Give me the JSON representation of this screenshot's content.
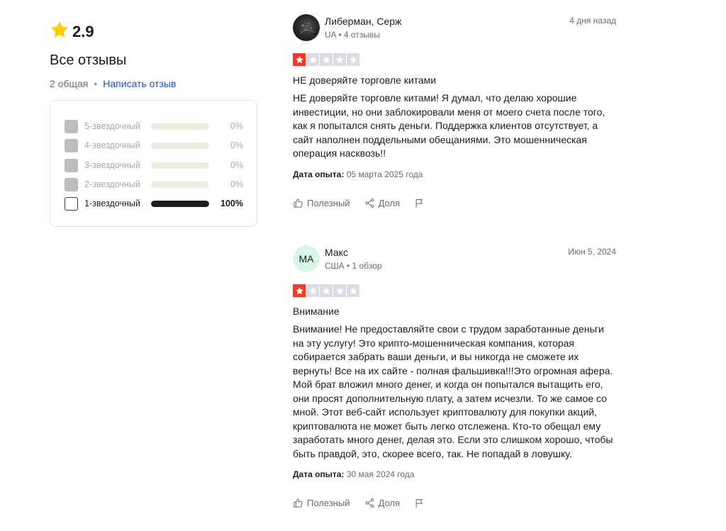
{
  "summary": {
    "rating": "2.9",
    "all_reviews_title": "Все отзывы",
    "total": "2 общая",
    "separator": "•",
    "write_review": "Написать отзыв"
  },
  "distribution": [
    {
      "label": "5-звездочный",
      "percent": "0%",
      "fraction": 0,
      "enabled": false
    },
    {
      "label": "4-звездочный",
      "percent": "0%",
      "fraction": 0,
      "enabled": false
    },
    {
      "label": "3-звездочный",
      "percent": "0%",
      "fraction": 0,
      "enabled": false
    },
    {
      "label": "2-звездочный",
      "percent": "0%",
      "fraction": 0,
      "enabled": false
    },
    {
      "label": "1-звездочный",
      "percent": "100%",
      "fraction": 1,
      "enabled": true
    }
  ],
  "reviews": [
    {
      "author": "Либерман, Серж",
      "meta": "UA • 4 отзывы",
      "date": "4 дня назад",
      "rating": 1,
      "title": "НЕ доверяйте торговле китами",
      "body": "НЕ доверяйте торговле китами! Я думал, что делаю хорошие инвестиции, но они заблокировали меня от моего счета после того, как я попытался снять деньги. Поддержка клиентов отсутствует, а сайт наполнен поддельными обещаниями. Это мошенническая операция насквозь!!",
      "experience_label": "Дата опыта:",
      "experience_date": "05 марта 2025 года",
      "helpful": "Полезный",
      "share": "Доля"
    },
    {
      "author": "Макс",
      "avatar_initials": "MA",
      "meta": "США • 1 обзор",
      "date": "Июн 5, 2024",
      "rating": 1,
      "title": "Внимание",
      "body": "Внимание! Не предоставляйте свои с трудом заработанные деньги на эту услугу! Это крипто-мошенническая компания, которая собирается забрать ваши деньги, и вы никогда не сможете их вернуть! Все на их сайте - полная фальшивка!!!Это огромная афера. Мой брат вложил много денег, и когда он попытался вытащить его, они просят дополнительную плату, а затем исчезли. То же самое со мной. Этот веб-сайт использует криптовалюту для покупки акций, криптовалюта не может быть легко отслежена. Кто-то обещал ему заработать много денег, делая это. Если это слишком хорошо, чтобы быть правдой, это, скорее всего, так. Не попадай в ловушку.",
      "experience_label": "Дата опыта:",
      "experience_date": "30 мая 2024 года",
      "helpful": "Полезный",
      "share": "Доля"
    }
  ],
  "colors": {
    "star_summary": "#ffcc00",
    "star_on": "#ff3722",
    "star_off": "#dcdce6",
    "link": "#1c4fb8"
  }
}
